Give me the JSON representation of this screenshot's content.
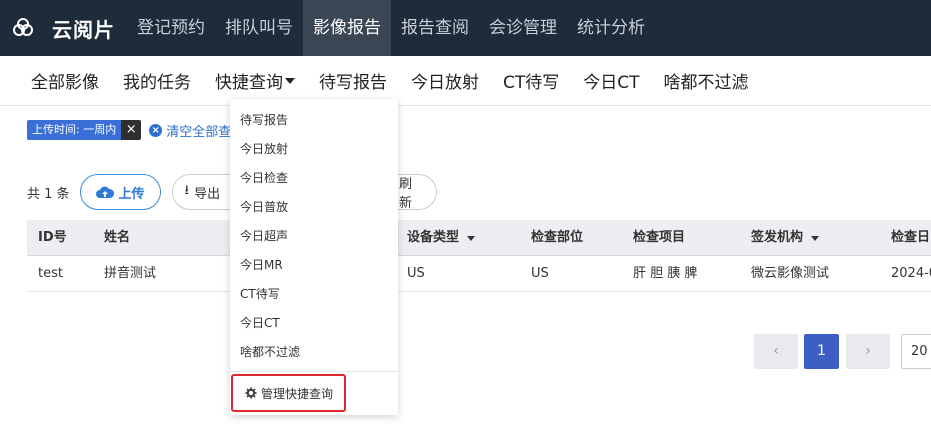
{
  "app": {
    "name": "云阅片"
  },
  "topnav": [
    {
      "label": "登记预约",
      "active": false
    },
    {
      "label": "排队叫号",
      "active": false
    },
    {
      "label": "影像报告",
      "active": true
    },
    {
      "label": "报告查阅",
      "active": false
    },
    {
      "label": "会诊管理",
      "active": false
    },
    {
      "label": "统计分析",
      "active": false
    }
  ],
  "subnav": {
    "items": [
      "全部影像",
      "我的任务",
      "快捷查询",
      "待写报告",
      "今日放射",
      "CT待写",
      "今日CT",
      "啥都不过滤"
    ]
  },
  "filter": {
    "chip_label": "上传时间: 一周内",
    "chip_close": "×",
    "clear_all": "清空全部查询"
  },
  "toolbar": {
    "count": "共 1 条",
    "upload": "上传",
    "export": "导出",
    "refresh": "刷新"
  },
  "table": {
    "headers": [
      "ID号",
      "姓名",
      "设备类型",
      "检查部位",
      "检查项目",
      "签发机构",
      "检查日"
    ],
    "row": [
      "test",
      "拼音测试",
      "US",
      "US",
      "肝 胆 胰 脾",
      "微云影像测试",
      "2024-0"
    ]
  },
  "pagination": {
    "prev": "‹",
    "current": "1",
    "next": "›",
    "page_size": "20"
  },
  "dropdown": {
    "items": [
      "待写报告",
      "今日放射",
      "今日检查",
      "今日普放",
      "今日超声",
      "今日MR",
      "CT待写",
      "今日CT",
      "啥都不过滤"
    ],
    "manage": "管理快捷查询"
  },
  "colors": {
    "topbar": "#1d2b3a",
    "active_tab": "#3a4654",
    "accent": "#3a6fd8",
    "highlight": "#e0262e"
  }
}
